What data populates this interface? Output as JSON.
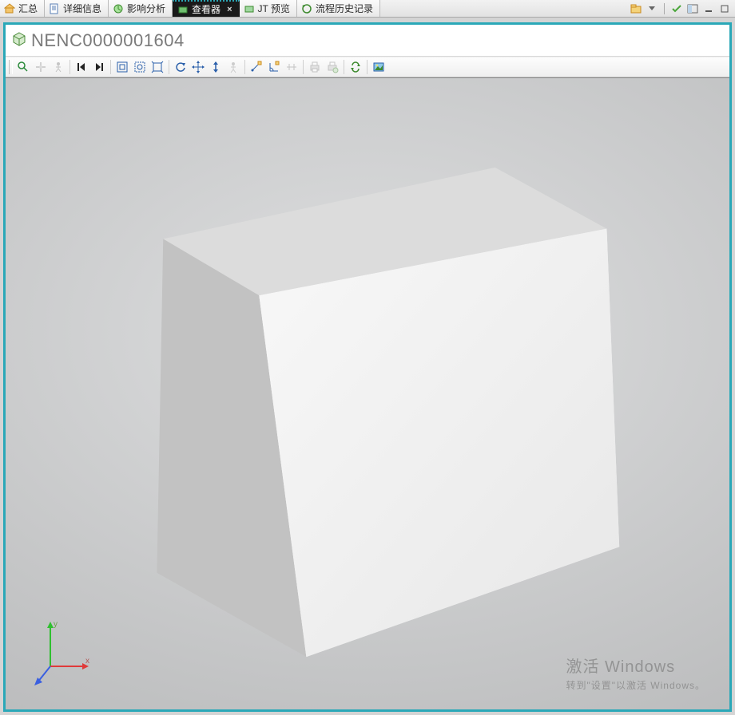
{
  "tabs": [
    {
      "label": "汇总"
    },
    {
      "label": "详细信息"
    },
    {
      "label": "影响分析"
    },
    {
      "label": "查看器",
      "active": true
    },
    {
      "label": "JT 预览"
    },
    {
      "label": "流程历史记录"
    }
  ],
  "title": "NENC0000001604",
  "toolbar": {
    "zoom": "zoom",
    "pan": "pan",
    "walk": "walk",
    "first": "first",
    "last": "last",
    "fit": "fit",
    "zoomarea": "zoom-area",
    "window": "window",
    "refresh": "refresh",
    "move": "move",
    "updown": "updown",
    "person": "person",
    "measure1": "measure1",
    "measure2": "measure2",
    "align": "align",
    "print": "print",
    "printsel": "printsel",
    "sync": "sync",
    "image": "image"
  },
  "watermark": {
    "line1": "激活 Windows",
    "line2": "转到\"设置\"以激活 Windows。"
  },
  "triad": {
    "x": "x",
    "y": "y"
  }
}
